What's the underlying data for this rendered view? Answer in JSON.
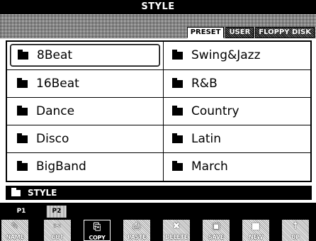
{
  "title": "STYLE",
  "tabs": [
    {
      "label": "PRESET",
      "active": true
    },
    {
      "label": "USER",
      "active": false
    },
    {
      "label": "FLOPPY DISK",
      "active": false
    }
  ],
  "items": [
    {
      "label": "8Beat",
      "selected": true
    },
    {
      "label": "Swing&Jazz"
    },
    {
      "label": "16Beat"
    },
    {
      "label": "R&B"
    },
    {
      "label": "Dance"
    },
    {
      "label": "Country"
    },
    {
      "label": "Disco"
    },
    {
      "label": "Latin"
    },
    {
      "label": "BigBand"
    },
    {
      "label": "March"
    }
  ],
  "path": "STYLE",
  "pages": [
    {
      "label": "P1",
      "active": true
    },
    {
      "label": "P2",
      "active": false
    }
  ],
  "functions": [
    {
      "label": "NAME",
      "icon": "name-icon",
      "glyph": "✎",
      "enabled": false
    },
    {
      "label": "CUT",
      "icon": "cut-icon",
      "glyph": "✂",
      "enabled": false
    },
    {
      "label": "COPY",
      "icon": "copy-icon",
      "glyph": "⎘",
      "enabled": true
    },
    {
      "label": "PASTE",
      "icon": "paste-icon",
      "glyph": "⎙",
      "enabled": false
    },
    {
      "label": "DELETE",
      "icon": "delete-icon",
      "glyph": "✖",
      "enabled": false
    },
    {
      "label": "SAVE",
      "icon": "save-icon",
      "glyph": "▣",
      "enabled": false
    },
    {
      "label": "NEW",
      "icon": "new-folder-icon",
      "glyph": "■",
      "enabled": false
    },
    {
      "label": "UP",
      "icon": "up-icon",
      "glyph": "↑",
      "enabled": false
    }
  ]
}
